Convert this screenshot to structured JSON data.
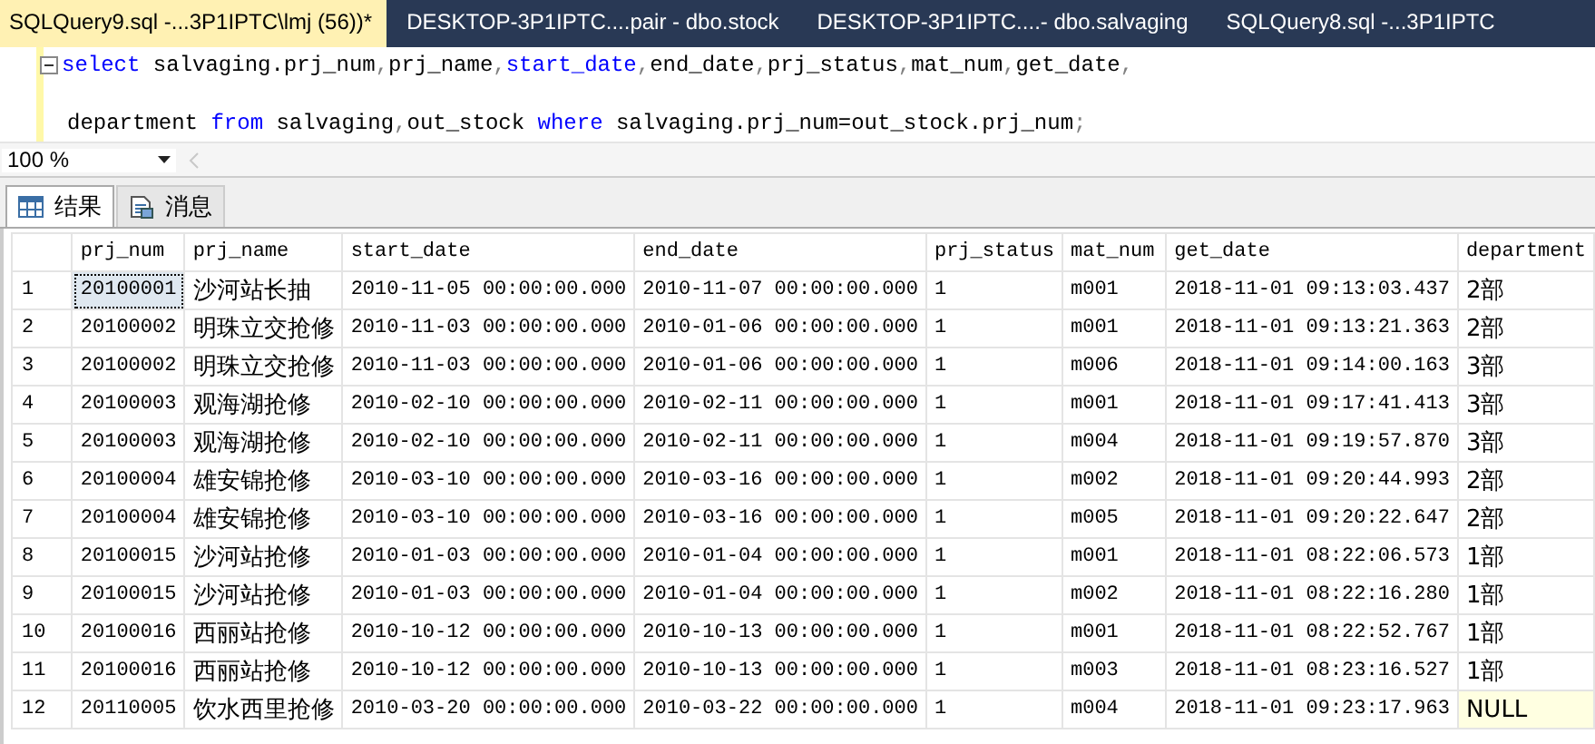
{
  "document_tabs": [
    {
      "label": "SQLQuery9.sql -...3P1IPTC\\lmj (56))*",
      "selected": true
    },
    {
      "label": "DESKTOP-3P1IPTC....pair - dbo.stock",
      "selected": false
    },
    {
      "label": "DESKTOP-3P1IPTC....- dbo.salvaging",
      "selected": false
    },
    {
      "label": "SQLQuery8.sql -...3P1IPTC",
      "selected": false
    }
  ],
  "editor": {
    "lines": [
      {
        "kind": "code",
        "tokens": [
          {
            "text": "select",
            "kind": "keyword"
          },
          {
            "text": " salvaging.prj_num",
            "kind": "plain"
          },
          {
            "text": ",",
            "kind": "punct"
          },
          {
            "text": "prj_name",
            "kind": "plain"
          },
          {
            "text": ",",
            "kind": "punct"
          },
          {
            "text": "start_date",
            "kind": "keyword"
          },
          {
            "text": ",",
            "kind": "punct"
          },
          {
            "text": "end_date",
            "kind": "plain"
          },
          {
            "text": ",",
            "kind": "punct"
          },
          {
            "text": "prj_status",
            "kind": "plain"
          },
          {
            "text": ",",
            "kind": "punct"
          },
          {
            "text": "mat_num",
            "kind": "plain"
          },
          {
            "text": ",",
            "kind": "punct"
          },
          {
            "text": "get_date",
            "kind": "plain"
          },
          {
            "text": ",",
            "kind": "punct"
          }
        ]
      },
      {
        "kind": "blank"
      },
      {
        "kind": "code",
        "tokens": [
          {
            "text": "department ",
            "kind": "plain"
          },
          {
            "text": "from",
            "kind": "keyword"
          },
          {
            "text": " salvaging",
            "kind": "plain"
          },
          {
            "text": ",",
            "kind": "punct"
          },
          {
            "text": "out_stock ",
            "kind": "plain"
          },
          {
            "text": "where",
            "kind": "keyword"
          },
          {
            "text": " salvaging.prj_num=out_stock.prj_num",
            "kind": "plain"
          },
          {
            "text": ";",
            "kind": "punct"
          }
        ]
      }
    ]
  },
  "zoom": {
    "value": "100 %"
  },
  "result_tabs": [
    {
      "label": "结果",
      "selected": true
    },
    {
      "label": "消息",
      "selected": false
    }
  ],
  "grid": {
    "columns": [
      "prj_num",
      "prj_name",
      "start_date",
      "end_date",
      "prj_status",
      "mat_num",
      "get_date",
      "department"
    ],
    "rows": [
      {
        "number": "1",
        "cells": [
          {
            "text": "20100001",
            "selected": true,
            "null": false
          },
          {
            "text": "沙河站长抽",
            "selected": false,
            "null": false
          },
          {
            "text": "2010-11-05 00:00:00.000",
            "selected": false,
            "null": false
          },
          {
            "text": "2010-11-07 00:00:00.000",
            "selected": false,
            "null": false
          },
          {
            "text": "1",
            "selected": false,
            "null": false
          },
          {
            "text": "m001",
            "selected": false,
            "null": false
          },
          {
            "text": "2018-11-01 09:13:03.437",
            "selected": false,
            "null": false
          },
          {
            "text": "2部",
            "selected": false,
            "null": false
          }
        ]
      },
      {
        "number": "2",
        "cells": [
          {
            "text": "20100002",
            "selected": false,
            "null": false
          },
          {
            "text": "明珠立交抢修",
            "selected": false,
            "null": false
          },
          {
            "text": "2010-11-03 00:00:00.000",
            "selected": false,
            "null": false
          },
          {
            "text": "2010-01-06 00:00:00.000",
            "selected": false,
            "null": false
          },
          {
            "text": "1",
            "selected": false,
            "null": false
          },
          {
            "text": "m001",
            "selected": false,
            "null": false
          },
          {
            "text": "2018-11-01 09:13:21.363",
            "selected": false,
            "null": false
          },
          {
            "text": "2部",
            "selected": false,
            "null": false
          }
        ]
      },
      {
        "number": "3",
        "cells": [
          {
            "text": "20100002",
            "selected": false,
            "null": false
          },
          {
            "text": "明珠立交抢修",
            "selected": false,
            "null": false
          },
          {
            "text": "2010-11-03 00:00:00.000",
            "selected": false,
            "null": false
          },
          {
            "text": "2010-01-06 00:00:00.000",
            "selected": false,
            "null": false
          },
          {
            "text": "1",
            "selected": false,
            "null": false
          },
          {
            "text": "m006",
            "selected": false,
            "null": false
          },
          {
            "text": "2018-11-01 09:14:00.163",
            "selected": false,
            "null": false
          },
          {
            "text": "3部",
            "selected": false,
            "null": false
          }
        ]
      },
      {
        "number": "4",
        "cells": [
          {
            "text": "20100003",
            "selected": false,
            "null": false
          },
          {
            "text": "观海湖抢修",
            "selected": false,
            "null": false
          },
          {
            "text": "2010-02-10 00:00:00.000",
            "selected": false,
            "null": false
          },
          {
            "text": "2010-02-11 00:00:00.000",
            "selected": false,
            "null": false
          },
          {
            "text": "1",
            "selected": false,
            "null": false
          },
          {
            "text": "m001",
            "selected": false,
            "null": false
          },
          {
            "text": "2018-11-01 09:17:41.413",
            "selected": false,
            "null": false
          },
          {
            "text": "3部",
            "selected": false,
            "null": false
          }
        ]
      },
      {
        "number": "5",
        "cells": [
          {
            "text": "20100003",
            "selected": false,
            "null": false
          },
          {
            "text": "观海湖抢修",
            "selected": false,
            "null": false
          },
          {
            "text": "2010-02-10 00:00:00.000",
            "selected": false,
            "null": false
          },
          {
            "text": "2010-02-11 00:00:00.000",
            "selected": false,
            "null": false
          },
          {
            "text": "1",
            "selected": false,
            "null": false
          },
          {
            "text": "m004",
            "selected": false,
            "null": false
          },
          {
            "text": "2018-11-01 09:19:57.870",
            "selected": false,
            "null": false
          },
          {
            "text": "3部",
            "selected": false,
            "null": false
          }
        ]
      },
      {
        "number": "6",
        "cells": [
          {
            "text": "20100004",
            "selected": false,
            "null": false
          },
          {
            "text": "雄安锦抢修",
            "selected": false,
            "null": false
          },
          {
            "text": "2010-03-10 00:00:00.000",
            "selected": false,
            "null": false
          },
          {
            "text": "2010-03-16 00:00:00.000",
            "selected": false,
            "null": false
          },
          {
            "text": "1",
            "selected": false,
            "null": false
          },
          {
            "text": "m002",
            "selected": false,
            "null": false
          },
          {
            "text": "2018-11-01 09:20:44.993",
            "selected": false,
            "null": false
          },
          {
            "text": "2部",
            "selected": false,
            "null": false
          }
        ]
      },
      {
        "number": "7",
        "cells": [
          {
            "text": "20100004",
            "selected": false,
            "null": false
          },
          {
            "text": "雄安锦抢修",
            "selected": false,
            "null": false
          },
          {
            "text": "2010-03-10 00:00:00.000",
            "selected": false,
            "null": false
          },
          {
            "text": "2010-03-16 00:00:00.000",
            "selected": false,
            "null": false
          },
          {
            "text": "1",
            "selected": false,
            "null": false
          },
          {
            "text": "m005",
            "selected": false,
            "null": false
          },
          {
            "text": "2018-11-01 09:20:22.647",
            "selected": false,
            "null": false
          },
          {
            "text": "2部",
            "selected": false,
            "null": false
          }
        ]
      },
      {
        "number": "8",
        "cells": [
          {
            "text": "20100015",
            "selected": false,
            "null": false
          },
          {
            "text": "沙河站抢修",
            "selected": false,
            "null": false
          },
          {
            "text": "2010-01-03 00:00:00.000",
            "selected": false,
            "null": false
          },
          {
            "text": "2010-01-04 00:00:00.000",
            "selected": false,
            "null": false
          },
          {
            "text": "1",
            "selected": false,
            "null": false
          },
          {
            "text": "m001",
            "selected": false,
            "null": false
          },
          {
            "text": "2018-11-01 08:22:06.573",
            "selected": false,
            "null": false
          },
          {
            "text": "1部",
            "selected": false,
            "null": false
          }
        ]
      },
      {
        "number": "9",
        "cells": [
          {
            "text": "20100015",
            "selected": false,
            "null": false
          },
          {
            "text": "沙河站抢修",
            "selected": false,
            "null": false
          },
          {
            "text": "2010-01-03 00:00:00.000",
            "selected": false,
            "null": false
          },
          {
            "text": "2010-01-04 00:00:00.000",
            "selected": false,
            "null": false
          },
          {
            "text": "1",
            "selected": false,
            "null": false
          },
          {
            "text": "m002",
            "selected": false,
            "null": false
          },
          {
            "text": "2018-11-01 08:22:16.280",
            "selected": false,
            "null": false
          },
          {
            "text": "1部",
            "selected": false,
            "null": false
          }
        ]
      },
      {
        "number": "10",
        "cells": [
          {
            "text": "20100016",
            "selected": false,
            "null": false
          },
          {
            "text": "西丽站抢修",
            "selected": false,
            "null": false
          },
          {
            "text": "2010-10-12 00:00:00.000",
            "selected": false,
            "null": false
          },
          {
            "text": "2010-10-13 00:00:00.000",
            "selected": false,
            "null": false
          },
          {
            "text": "1",
            "selected": false,
            "null": false
          },
          {
            "text": "m001",
            "selected": false,
            "null": false
          },
          {
            "text": "2018-11-01 08:22:52.767",
            "selected": false,
            "null": false
          },
          {
            "text": "1部",
            "selected": false,
            "null": false
          }
        ]
      },
      {
        "number": "11",
        "cells": [
          {
            "text": "20100016",
            "selected": false,
            "null": false
          },
          {
            "text": "西丽站抢修",
            "selected": false,
            "null": false
          },
          {
            "text": "2010-10-12 00:00:00.000",
            "selected": false,
            "null": false
          },
          {
            "text": "2010-10-13 00:00:00.000",
            "selected": false,
            "null": false
          },
          {
            "text": "1",
            "selected": false,
            "null": false
          },
          {
            "text": "m003",
            "selected": false,
            "null": false
          },
          {
            "text": "2018-11-01 08:23:16.527",
            "selected": false,
            "null": false
          },
          {
            "text": "1部",
            "selected": false,
            "null": false
          }
        ]
      },
      {
        "number": "12",
        "cells": [
          {
            "text": "20110005",
            "selected": false,
            "null": false
          },
          {
            "text": "饮水西里抢修",
            "selected": false,
            "null": false
          },
          {
            "text": "2010-03-20 00:00:00.000",
            "selected": false,
            "null": false
          },
          {
            "text": "2010-03-22 00:00:00.000",
            "selected": false,
            "null": false
          },
          {
            "text": "1",
            "selected": false,
            "null": false
          },
          {
            "text": "m004",
            "selected": false,
            "null": false
          },
          {
            "text": "2018-11-01 09:23:17.963",
            "selected": false,
            "null": false
          },
          {
            "text": "NULL",
            "selected": false,
            "null": true
          }
        ]
      }
    ]
  }
}
